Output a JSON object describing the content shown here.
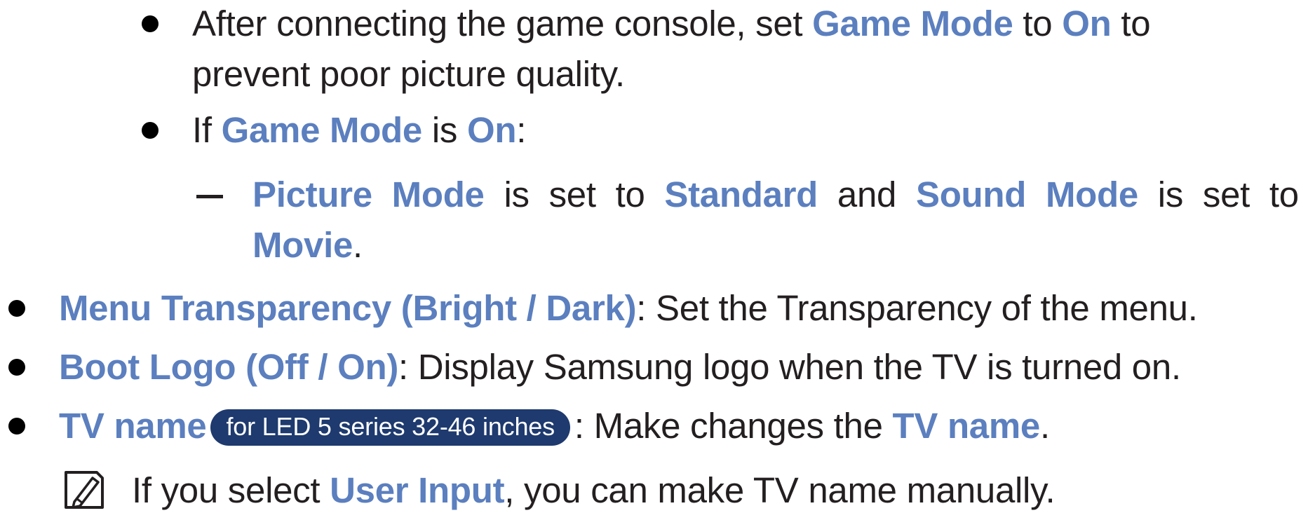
{
  "colors": {
    "keyword": "#5b7fbf",
    "body_text": "#231f20",
    "pill_background": "#1e3a6e",
    "pill_text": "#ffffff"
  },
  "icons": {
    "note": "note-pencil-icon",
    "bullet": "filled-circle-bullet",
    "dash": "en-dash-bullet"
  },
  "game_console": {
    "line1": {
      "t1": "After connecting the game console, set ",
      "k1": "Game Mode",
      "t2": " to ",
      "k2": "On",
      "t3": " to"
    },
    "line2": "prevent poor picture quality."
  },
  "game_mode_on": {
    "t1": "If ",
    "k1": "Game Mode",
    "t2": " is ",
    "k2": "On",
    "t3": ":"
  },
  "picture_sound": {
    "line1": {
      "k1": "Picture Mode",
      "t1": " is set to ",
      "k2": "Standard",
      "t2": " and ",
      "k3": "Sound Mode",
      "t3": " is set to"
    },
    "line2": {
      "k1": "Movie",
      "t1": "."
    }
  },
  "menu_transparency": {
    "k1": "Menu Transparency (Bright / Dark)",
    "t1": ": Set the Transparency of the menu."
  },
  "boot_logo": {
    "k1": "Boot Logo (Off / On)",
    "t1": ": Display Samsung logo when the TV is turned on."
  },
  "tv_name": {
    "k1": "TV name",
    "badge": "for LED 5 series 32-46 inches",
    "t1": ": Make changes the ",
    "k2": "TV name",
    "t2": "."
  },
  "note": {
    "t1": "If you select ",
    "k1": "User Input",
    "t2": ", you can make TV name manually."
  }
}
